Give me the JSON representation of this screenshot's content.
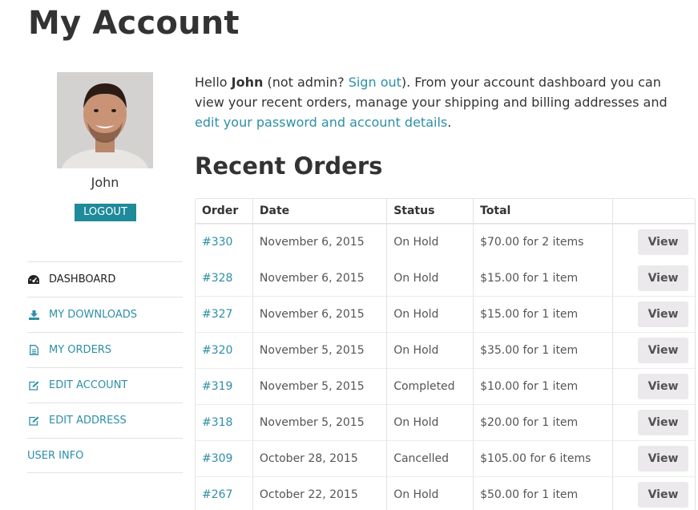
{
  "page": {
    "title": "My Account"
  },
  "sidebar": {
    "username": "John",
    "logout_label": "LOGOUT",
    "nav": [
      {
        "label": "DASHBOARD",
        "icon": "dashboard-icon",
        "active": true
      },
      {
        "label": "MY DOWNLOADS",
        "icon": "download-icon"
      },
      {
        "label": "MY ORDERS",
        "icon": "document-icon"
      },
      {
        "label": "EDIT ACCOUNT",
        "icon": "edit-icon"
      },
      {
        "label": "EDIT ADDRESS",
        "icon": "edit-icon"
      },
      {
        "label": "USER INFO",
        "icon": ""
      }
    ]
  },
  "intro": {
    "greeting": "Hello ",
    "name": "John",
    "not_prefix": " (not admin? ",
    "sign_out": "Sign out",
    "middle": "). From your account dashboard you can view your recent orders, manage your shipping and billing addresses and ",
    "edit_link": "edit your password and account details",
    "end": "."
  },
  "orders": {
    "title": "Recent Orders",
    "columns": [
      "Order",
      "Date",
      "Status",
      "Total",
      ""
    ],
    "view_label": "View",
    "rows": [
      {
        "order": "#330",
        "date": "November 6, 2015",
        "status": "On Hold",
        "total": "$70.00 for 2 items"
      },
      {
        "order": "#328",
        "date": "November 6, 2015",
        "status": "On Hold",
        "total": "$15.00 for 1 item"
      },
      {
        "order": "#327",
        "date": "November 6, 2015",
        "status": "On Hold",
        "total": "$15.00 for 1 item"
      },
      {
        "order": "#320",
        "date": "November 5, 2015",
        "status": "On Hold",
        "total": "$35.00 for 1 item"
      },
      {
        "order": "#319",
        "date": "November 5, 2015",
        "status": "Completed",
        "total": "$10.00 for 1 item"
      },
      {
        "order": "#318",
        "date": "November 5, 2015",
        "status": "On Hold",
        "total": "$20.00 for 1 item"
      },
      {
        "order": "#309",
        "date": "October 28, 2015",
        "status": "Cancelled",
        "total": "$105.00 for 6 items"
      },
      {
        "order": "#267",
        "date": "October 22, 2015",
        "status": "On Hold",
        "total": "$50.00 for 1 item"
      }
    ]
  },
  "colors": {
    "accent": "#1e8a9a",
    "link": "#2d8fa8",
    "button_bg": "#ebe9eb"
  }
}
